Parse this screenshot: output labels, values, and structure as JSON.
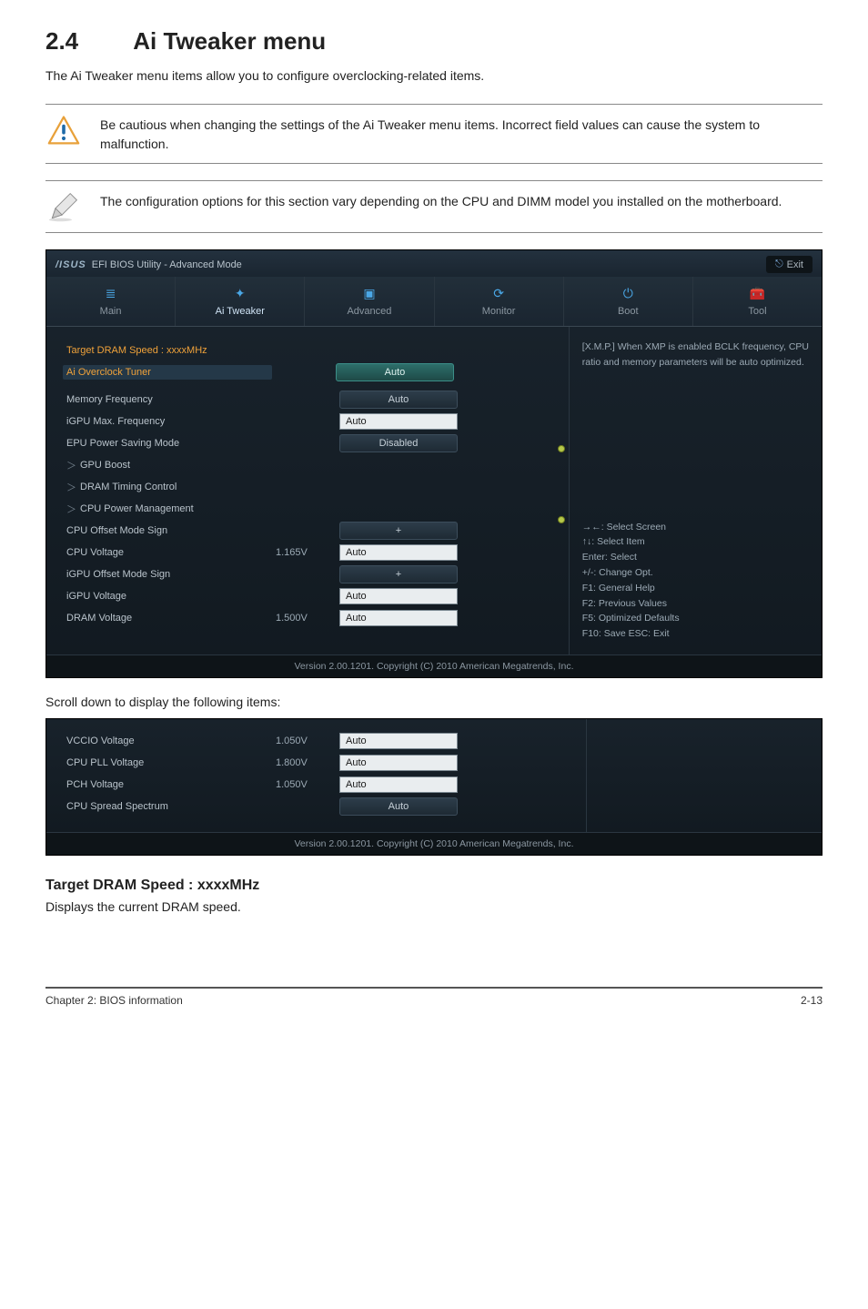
{
  "section": {
    "number": "2.4",
    "title": "Ai Tweaker menu"
  },
  "intro": "The Ai Tweaker menu items allow you to configure overclocking-related items.",
  "warning_note": "Be cautious when changing the settings of the Ai Tweaker menu items. Incorrect field values can cause the system to malfunction.",
  "info_note": "The configuration options for this section vary depending on the CPU and DIMM model you installed on the motherboard.",
  "bios": {
    "brand_text": "/ISUS",
    "title": "EFI BIOS Utility - Advanced Mode",
    "exit_label": "Exit",
    "tabs": {
      "main": "Main",
      "ai_tweaker": "Ai  Tweaker",
      "advanced": "Advanced",
      "monitor": "Monitor",
      "boot": "Boot",
      "tool": "Tool"
    },
    "help_top": "[X.M.P.] When XMP is enabled BCLK frequency, CPU ratio and memory parameters will be auto optimized.",
    "help_keys": [
      "→←: Select Screen",
      "↑↓: Select Item",
      "Enter: Select",
      "+/-: Change Opt.",
      "F1: General Help",
      "F2: Previous Values",
      "F5: Optimized Defaults",
      "F10: Save   ESC: Exit"
    ],
    "rows": {
      "target_dram": "Target DRAM Speed : xxxxMHz",
      "ai_overclock_tuner": {
        "label": "Ai Overclock Tuner",
        "value": "Auto"
      },
      "memory_frequency": {
        "label": "Memory Frequency",
        "value": "Auto"
      },
      "igpu_max_freq": {
        "label": "iGPU Max. Frequency",
        "value": "Auto"
      },
      "epu_power_saving": {
        "label": "EPU Power Saving Mode",
        "value": "Disabled"
      },
      "gpu_boost": "GPU Boost",
      "dram_timing": "DRAM Timing Control",
      "cpu_power_mgmt": "CPU Power Management",
      "cpu_offset_sign": {
        "label": "CPU Offset Mode Sign",
        "value": "+"
      },
      "cpu_voltage": {
        "label": "CPU Voltage",
        "mid": "1.165V",
        "value": "Auto"
      },
      "igpu_offset_sign": {
        "label": "iGPU Offset Mode Sign",
        "value": "+"
      },
      "igpu_voltage": {
        "label": "iGPU Voltage",
        "value": "Auto"
      },
      "dram_voltage": {
        "label": "DRAM Voltage",
        "mid": "1.500V",
        "value": "Auto"
      }
    },
    "footer": "Version 2.00.1201.  Copyright (C) 2010 American Megatrends, Inc."
  },
  "scroll_caption": "Scroll down to display the following items:",
  "bios2": {
    "rows": {
      "vccio": {
        "label": "VCCIO Voltage",
        "mid": "1.050V",
        "value": "Auto"
      },
      "cpu_pll": {
        "label": "CPU PLL Voltage",
        "mid": "1.800V",
        "value": "Auto"
      },
      "pch": {
        "label": "PCH Voltage",
        "mid": "1.050V",
        "value": "Auto"
      },
      "cpu_spread": {
        "label": "CPU Spread Spectrum",
        "value": "Auto"
      }
    },
    "footer": "Version 2.00.1201.  Copyright (C) 2010 American Megatrends, Inc."
  },
  "sub": {
    "heading": "Target DRAM Speed : xxxxMHz",
    "text": "Displays the current DRAM speed."
  },
  "footer": {
    "left": "Chapter 2: BIOS information",
    "right": "2-13"
  }
}
